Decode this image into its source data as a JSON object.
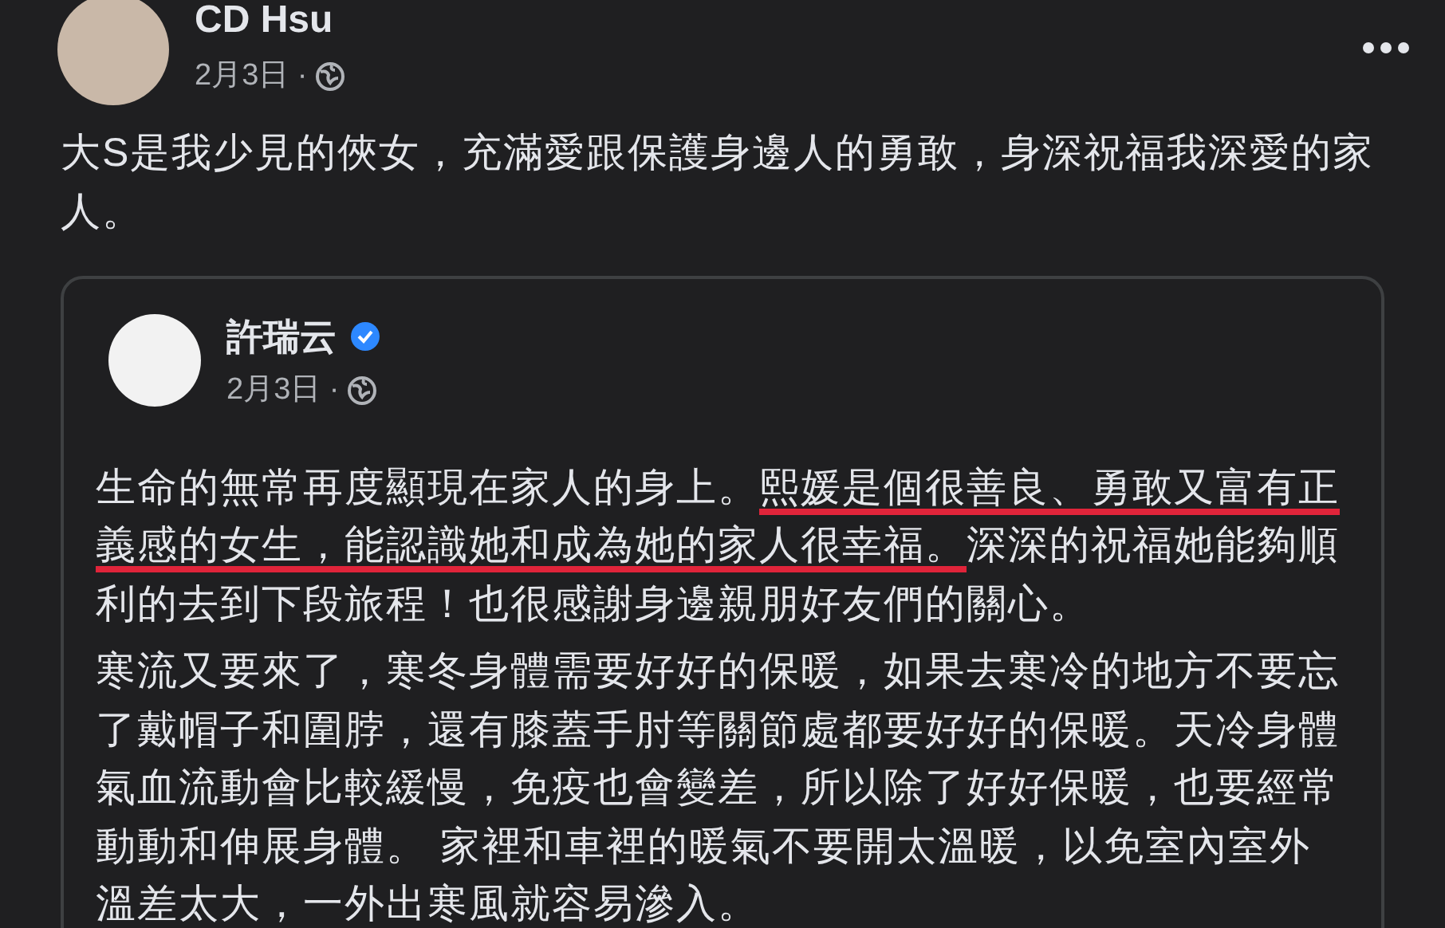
{
  "post": {
    "author": "CD Hsu",
    "date": "2月3日 ·",
    "text_lines": [
      [
        {
          "text": "大S是我少見的俠女，充滿愛跟保護身邊人的勇敢，身深祝福我深愛的家",
          "underlined": false
        }
      ],
      [
        {
          "text": "人。",
          "underlined": false
        }
      ]
    ]
  },
  "shared_post": {
    "author": "許瑞云",
    "verified": true,
    "date": "2月3日 ·",
    "paragraphs": [
      [
        [
          {
            "text": "生命的無常再度顯現在家人的身上。",
            "underlined": false
          },
          {
            "text": "熙媛是個很善良、勇敢又富有正",
            "underlined": true
          }
        ],
        [
          {
            "text": "義感的女生，能認識她和成為她的家人很幸福。",
            "underlined": true
          },
          {
            "text": "深深的祝福她能夠順",
            "underlined": false
          }
        ],
        [
          {
            "text": "利的去到下段旅程！也很感謝身邊親朋好友們的關心。",
            "underlined": false
          }
        ]
      ],
      [
        [
          {
            "text": "寒流又要來了，寒冬身體需要好好的保暖，如果去寒冷的地方不要忘",
            "underlined": false
          }
        ],
        [
          {
            "text": "了戴帽子和圍脖，還有膝蓋手肘等關節處都要好好的保暖。天冷身體",
            "underlined": false
          }
        ],
        [
          {
            "text": "氣血流動會比較緩慢，免疫也會變差，所以除了好好保暖，也要經常",
            "underlined": false
          }
        ],
        [
          {
            "text": "動動和伸展身體。 家裡和車裡的暖氣不要開太溫暖，以免室內室外",
            "underlined": false
          }
        ],
        [
          {
            "text": "溫差太大，一外出寒風就容易滲入。",
            "underlined": false
          }
        ]
      ]
    ]
  }
}
